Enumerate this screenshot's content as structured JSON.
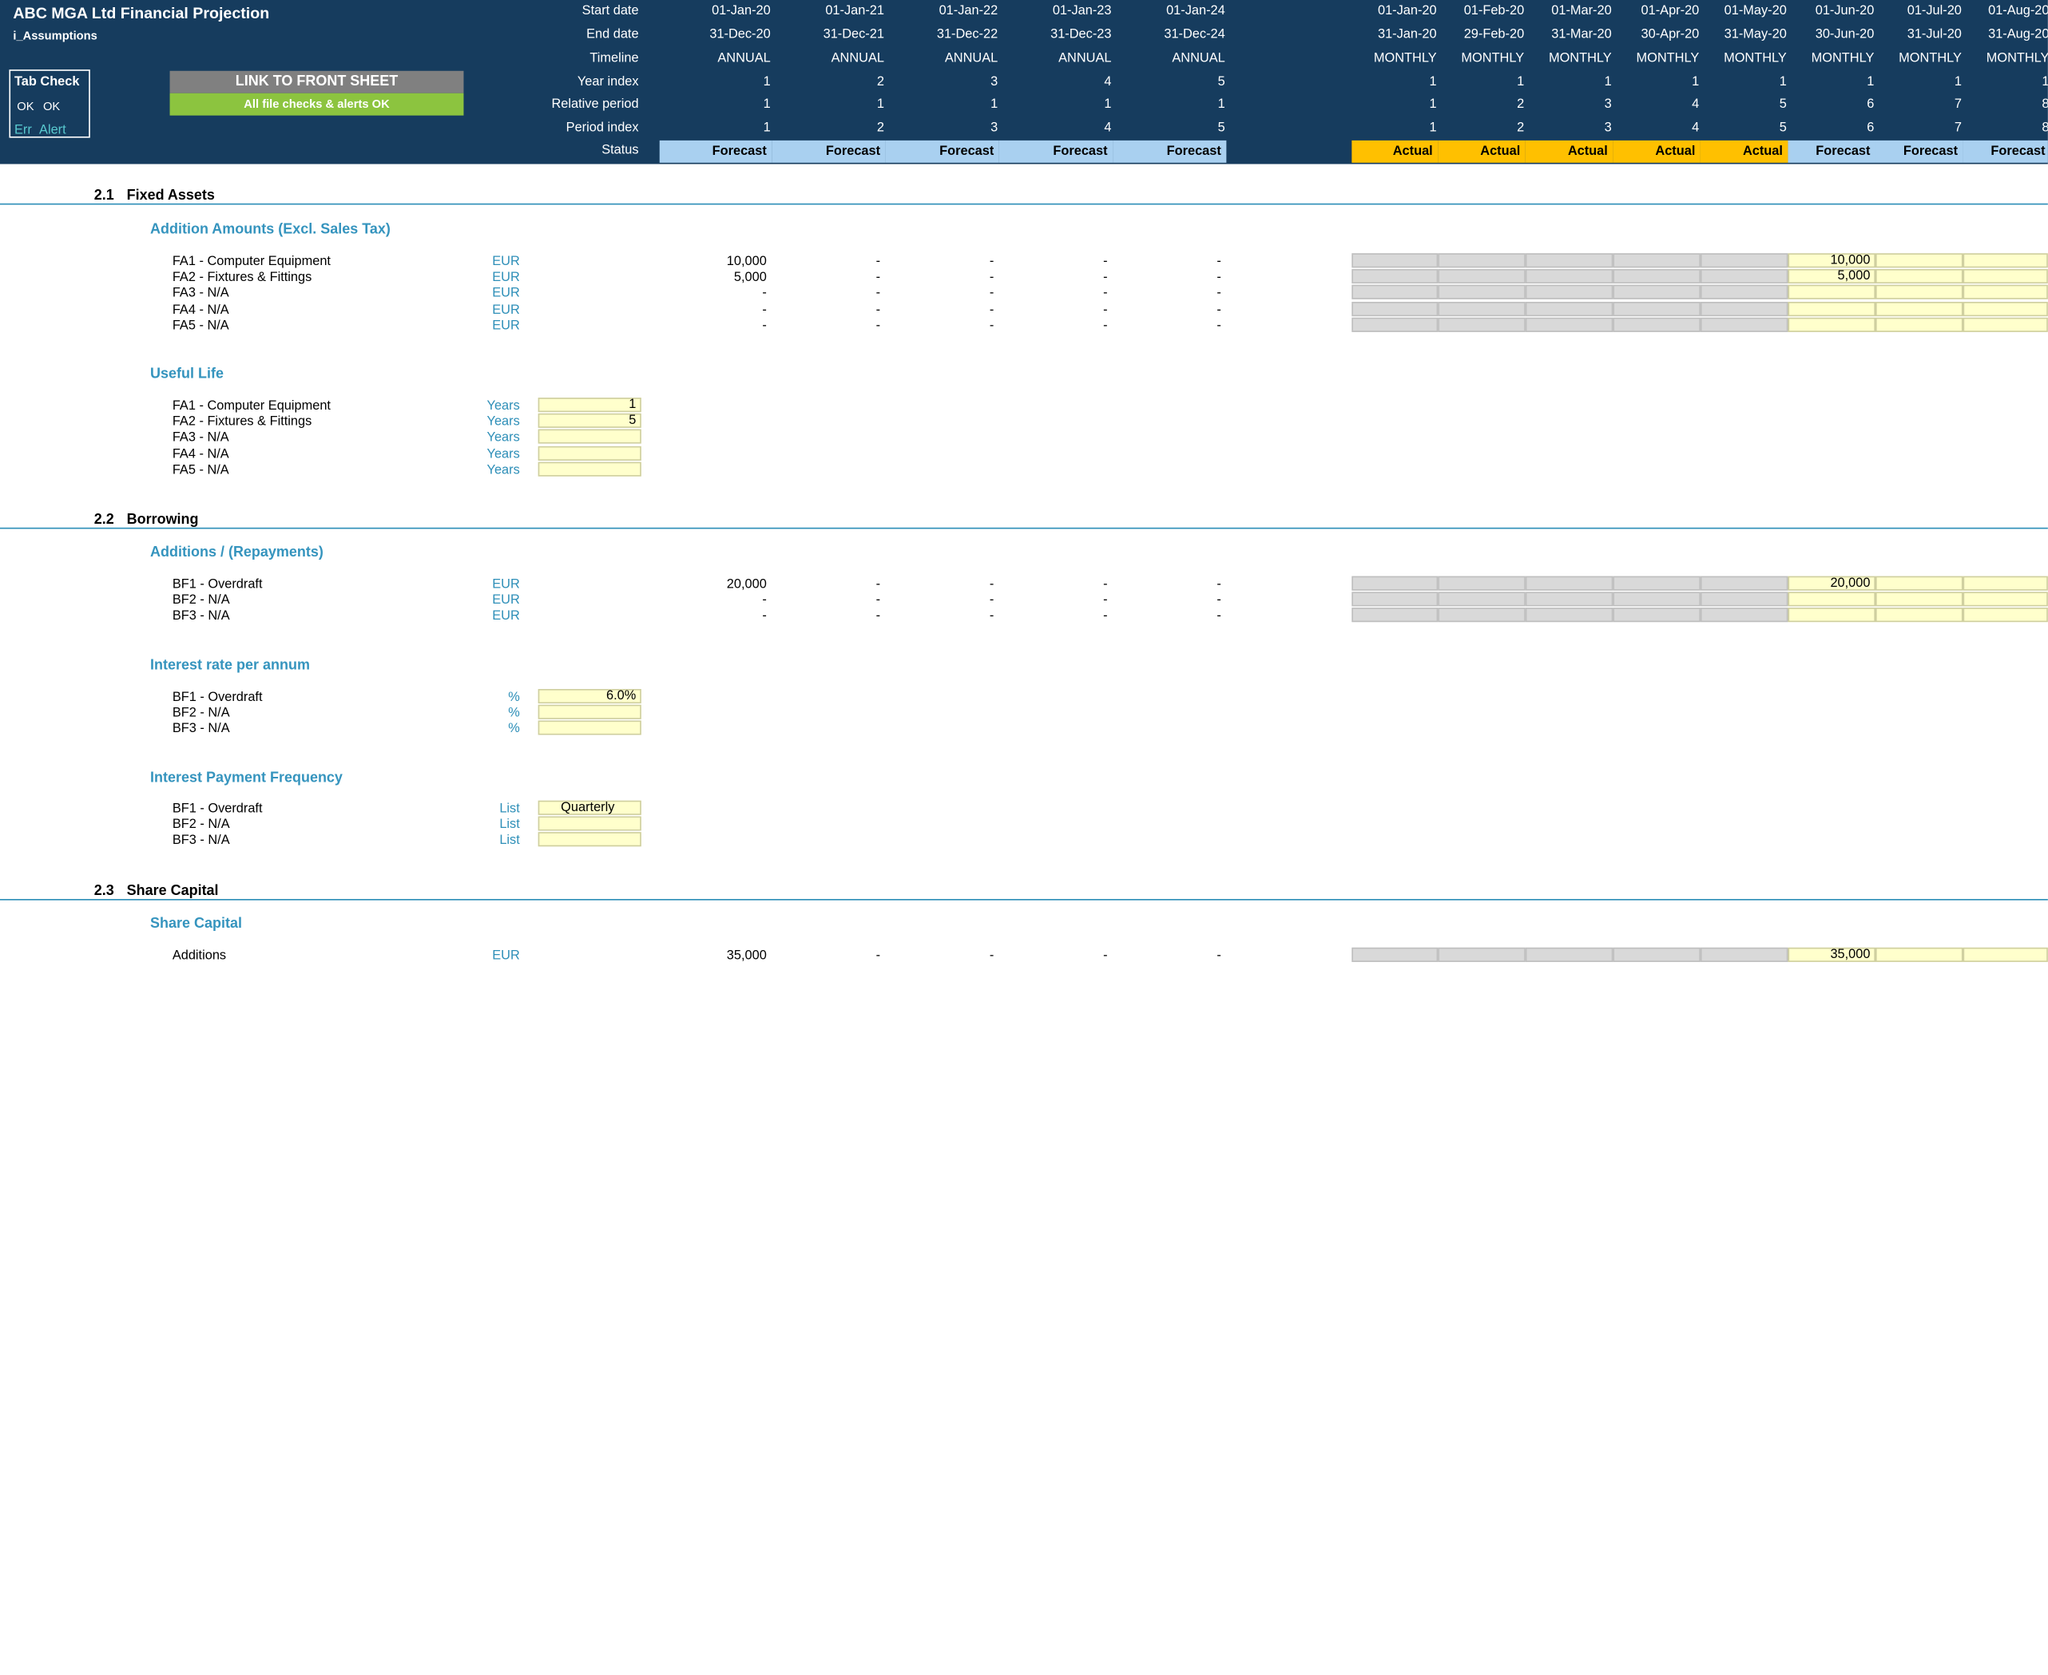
{
  "header": {
    "title": "ABC MGA Ltd Financial Projection",
    "sheet_name": "i_Assumptions",
    "tab_check": {
      "title": "Tab Check",
      "ok1": "OK",
      "ok2": "OK",
      "err": "Err",
      "alert": "Alert"
    },
    "link_button": "LINK TO FRONT SHEET",
    "status_banner": "All file checks & alerts OK",
    "row_labels": [
      "Start date",
      "End date",
      "Timeline",
      "Year index",
      "Relative period",
      "Period index",
      "Status"
    ],
    "annual": [
      {
        "start": "01-Jan-20",
        "end": "31-Dec-20",
        "timeline": "ANNUAL",
        "year": "1",
        "rel": "1",
        "period": "1",
        "status": "Forecast"
      },
      {
        "start": "01-Jan-21",
        "end": "31-Dec-21",
        "timeline": "ANNUAL",
        "year": "2",
        "rel": "1",
        "period": "2",
        "status": "Forecast"
      },
      {
        "start": "01-Jan-22",
        "end": "31-Dec-22",
        "timeline": "ANNUAL",
        "year": "3",
        "rel": "1",
        "period": "3",
        "status": "Forecast"
      },
      {
        "start": "01-Jan-23",
        "end": "31-Dec-23",
        "timeline": "ANNUAL",
        "year": "4",
        "rel": "1",
        "period": "4",
        "status": "Forecast"
      },
      {
        "start": "01-Jan-24",
        "end": "31-Dec-24",
        "timeline": "ANNUAL",
        "year": "5",
        "rel": "1",
        "period": "5",
        "status": "Forecast"
      }
    ],
    "monthly": [
      {
        "start": "01-Jan-20",
        "end": "31-Jan-20",
        "timeline": "MONTHLY",
        "year": "1",
        "rel": "1",
        "period": "1",
        "status": "Actual"
      },
      {
        "start": "01-Feb-20",
        "end": "29-Feb-20",
        "timeline": "MONTHLY",
        "year": "1",
        "rel": "2",
        "period": "2",
        "status": "Actual"
      },
      {
        "start": "01-Mar-20",
        "end": "31-Mar-20",
        "timeline": "MONTHLY",
        "year": "1",
        "rel": "3",
        "period": "3",
        "status": "Actual"
      },
      {
        "start": "01-Apr-20",
        "end": "30-Apr-20",
        "timeline": "MONTHLY",
        "year": "1",
        "rel": "4",
        "period": "4",
        "status": "Actual"
      },
      {
        "start": "01-May-20",
        "end": "31-May-20",
        "timeline": "MONTHLY",
        "year": "1",
        "rel": "5",
        "period": "5",
        "status": "Actual"
      },
      {
        "start": "01-Jun-20",
        "end": "30-Jun-20",
        "timeline": "MONTHLY",
        "year": "1",
        "rel": "6",
        "period": "6",
        "status": "Forecast"
      },
      {
        "start": "01-Jul-20",
        "end": "31-Jul-20",
        "timeline": "MONTHLY",
        "year": "1",
        "rel": "7",
        "period": "7",
        "status": "Forecast"
      },
      {
        "start": "01-Aug-20",
        "end": "31-Aug-20",
        "timeline": "MONTHLY",
        "year": "1",
        "rel": "8",
        "period": "8",
        "status": "Forecast"
      }
    ]
  },
  "colors": {
    "header_bg": "#163C5E",
    "forecast": "#A9D0F0",
    "actual": "#FFC000",
    "grey_cell": "#D9D9D9",
    "input_cell": "#FFFFCC",
    "accent": "#3594BE",
    "button_grey": "#808080",
    "button_green": "#8CC43F"
  },
  "sections": {
    "fixed_assets": {
      "number": "2.1",
      "title": "Fixed Assets",
      "additions": {
        "title": "Addition Amounts (Excl. Sales Tax)",
        "rows": [
          {
            "label": "FA1 - Computer Equipment",
            "unit": "EUR",
            "annual": [
              "10,000",
              "-",
              "-",
              "-",
              "-"
            ],
            "jun": "10,000"
          },
          {
            "label": "FA2 - Fixtures & Fittings",
            "unit": "EUR",
            "annual": [
              "5,000",
              "-",
              "-",
              "-",
              "-"
            ],
            "jun": "5,000"
          },
          {
            "label": "FA3 - N/A",
            "unit": "EUR",
            "annual": [
              "-",
              "-",
              "-",
              "-",
              "-"
            ],
            "jun": ""
          },
          {
            "label": "FA4 - N/A",
            "unit": "EUR",
            "annual": [
              "-",
              "-",
              "-",
              "-",
              "-"
            ],
            "jun": ""
          },
          {
            "label": "FA5 - N/A",
            "unit": "EUR",
            "annual": [
              "-",
              "-",
              "-",
              "-",
              "-"
            ],
            "jun": ""
          }
        ]
      },
      "useful_life": {
        "title": "Useful Life",
        "rows": [
          {
            "label": "FA1 - Computer Equipment",
            "unit": "Years",
            "value": "1"
          },
          {
            "label": "FA2 - Fixtures & Fittings",
            "unit": "Years",
            "value": "5"
          },
          {
            "label": "FA3 - N/A",
            "unit": "Years",
            "value": ""
          },
          {
            "label": "FA4 - N/A",
            "unit": "Years",
            "value": ""
          },
          {
            "label": "FA5 - N/A",
            "unit": "Years",
            "value": ""
          }
        ]
      }
    },
    "borrowing": {
      "number": "2.2",
      "title": "Borrowing",
      "additions": {
        "title": "Additions / (Repayments)",
        "rows": [
          {
            "label": "BF1 - Overdraft",
            "unit": "EUR",
            "annual": [
              "20,000",
              "-",
              "-",
              "-",
              "-"
            ],
            "jun": "20,000"
          },
          {
            "label": "BF2 - N/A",
            "unit": "EUR",
            "annual": [
              "-",
              "-",
              "-",
              "-",
              "-"
            ],
            "jun": ""
          },
          {
            "label": "BF3 - N/A",
            "unit": "EUR",
            "annual": [
              "-",
              "-",
              "-",
              "-",
              "-"
            ],
            "jun": ""
          }
        ]
      },
      "interest_rate": {
        "title": "Interest rate per annum",
        "rows": [
          {
            "label": "BF1 - Overdraft",
            "unit": "%",
            "value": "6.0%"
          },
          {
            "label": "BF2 - N/A",
            "unit": "%",
            "value": ""
          },
          {
            "label": "BF3 - N/A",
            "unit": "%",
            "value": ""
          }
        ]
      },
      "payment_frequency": {
        "title": "Interest Payment Frequency",
        "rows": [
          {
            "label": "BF1 - Overdraft",
            "unit": "List",
            "value": "Quarterly"
          },
          {
            "label": "BF2 - N/A",
            "unit": "List",
            "value": ""
          },
          {
            "label": "BF3 - N/A",
            "unit": "List",
            "value": ""
          }
        ]
      }
    },
    "share_capital": {
      "number": "2.3",
      "title": "Share Capital",
      "additions": {
        "title": "Share Capital",
        "rows": [
          {
            "label": "Additions",
            "unit": "EUR",
            "annual": [
              "35,000",
              "-",
              "-",
              "-",
              "-"
            ],
            "jun": "35,000"
          }
        ]
      }
    }
  }
}
